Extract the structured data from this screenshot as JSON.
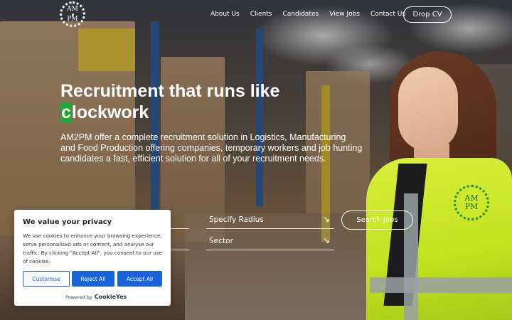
{
  "header": {
    "logo_top": "AM",
    "logo_bottom": "PM",
    "nav": [
      "About Us",
      "Clients",
      "Candidates",
      "View Jobs",
      "Contact Us"
    ],
    "drop_cv": "Drop CV"
  },
  "hero": {
    "title_line1": "Recruitment that runs like",
    "title_highlight": "c",
    "title_line2_rest": "lockwork",
    "description": "AM2PM offer a complete recruitment solution in Logistics, Manufacturing and Food Production offering companies, temporary workers and job hunting candidates a fast, efficient solution for all of your recruitment needs."
  },
  "search": {
    "radius_label": "Specify Radius",
    "sector_label": "Sector",
    "search_button": "Search Jobs"
  },
  "vest_logo": {
    "top": "AM",
    "bottom": "PM"
  },
  "cookie": {
    "title": "We value your privacy",
    "body": "We use cookies to enhance your browsing experience, serve personalised ads or content, and analyse our traffic. By clicking \"Accept All\", you consent to our use of cookies.",
    "customise": "Customise",
    "reject": "Reject All",
    "accept": "Accept All",
    "powered_by": "Powered by",
    "brand": "CookieYes"
  },
  "colors": {
    "accent_green": "#1ca834",
    "cookie_blue": "#1863dc",
    "vest_yellow": "#c2e21f"
  }
}
